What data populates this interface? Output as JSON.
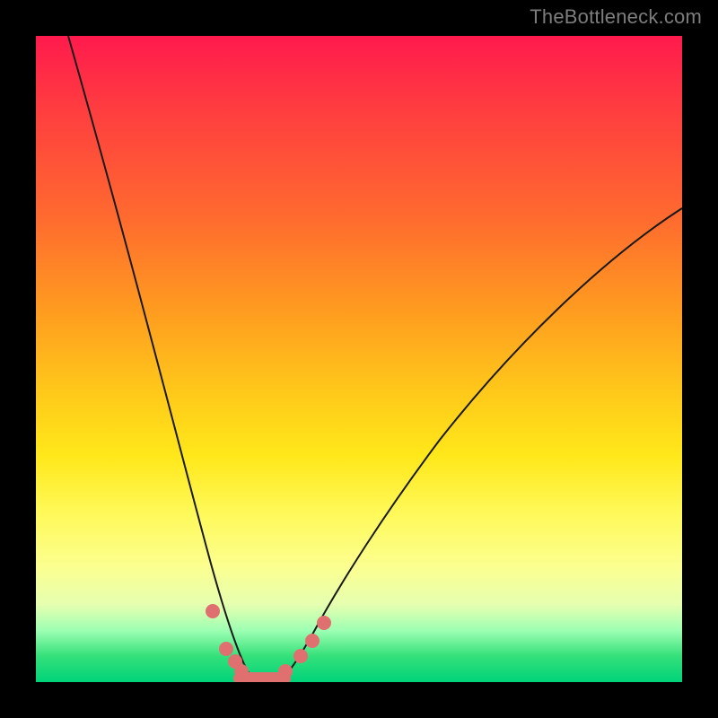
{
  "watermark": {
    "text": "TheBottleneck.com"
  },
  "chart_data": {
    "type": "line",
    "title": "",
    "xlabel": "",
    "ylabel": "",
    "xlim": [
      0,
      100
    ],
    "ylim": [
      0,
      100
    ],
    "gradient_colors": {
      "top": "#ff1a4d",
      "bottom": "#00d37a"
    },
    "series": [
      {
        "name": "left-curve",
        "x": [
          5,
          8,
          11,
          14,
          17,
          20,
          22,
          24,
          26,
          27,
          28.5,
          30,
          31.5,
          33
        ],
        "y": [
          100,
          88,
          76,
          65,
          54,
          43,
          34,
          26,
          18,
          12,
          7,
          3.5,
          1.5,
          0.5
        ],
        "color": "#1a1a1a",
        "width": 2
      },
      {
        "name": "right-curve",
        "x": [
          38,
          40,
          42,
          45,
          49,
          54,
          60,
          66,
          72,
          78,
          84,
          90,
          96,
          100
        ],
        "y": [
          0.5,
          2,
          5,
          10,
          17,
          25,
          33,
          41,
          48,
          54,
          60,
          65,
          70,
          73
        ],
        "color": "#1a1a1a",
        "width": 2
      },
      {
        "name": "left-markers",
        "type": "scatter",
        "x": [
          27.3,
          29.4,
          30.8,
          31.8
        ],
        "y": [
          11.0,
          5.2,
          3.3,
          1.6
        ],
        "color": "#e07070",
        "marker_radius": 8
      },
      {
        "name": "right-markers",
        "type": "scatter",
        "x": [
          38.6,
          41.0,
          42.8,
          44.6
        ],
        "y": [
          1.6,
          4.0,
          6.4,
          9.2
        ],
        "color": "#e07070",
        "marker_radius": 8
      },
      {
        "name": "bottom-segment",
        "type": "line",
        "x": [
          31.5,
          38.5
        ],
        "y": [
          0.5,
          0.5
        ],
        "color": "#e07070",
        "width": 14
      }
    ]
  }
}
